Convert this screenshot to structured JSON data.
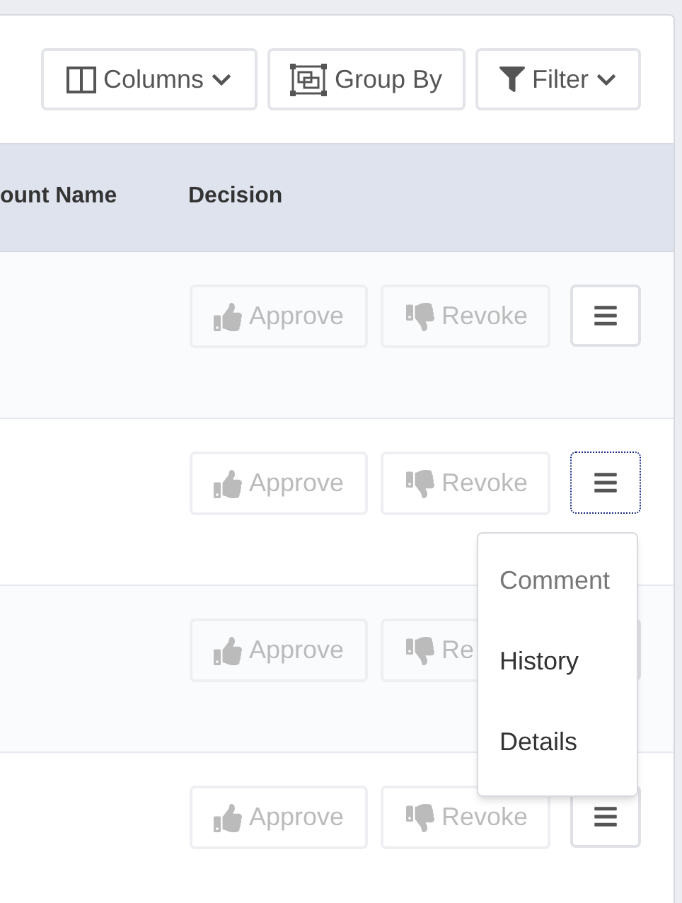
{
  "toolbar": {
    "buttons": [
      {
        "kind": "columns",
        "label": "Columns",
        "caret": true
      },
      {
        "kind": "group",
        "label": "Group By",
        "caret": false
      },
      {
        "kind": "filter",
        "label": "Filter",
        "caret": true
      }
    ]
  },
  "table": {
    "columns": [
      "ount Name",
      "Decision"
    ],
    "rows": [
      {
        "approve": "Approve",
        "revoke": "Revoke",
        "approve_disabled": true,
        "revoke_disabled": true,
        "focused": false
      },
      {
        "approve": "Approve",
        "revoke": "Revoke",
        "approve_disabled": true,
        "revoke_disabled": true,
        "focused": true
      },
      {
        "approve": "Approve",
        "revoke": "Re",
        "approve_disabled": true,
        "revoke_disabled": true,
        "focused": false,
        "menu_icon": false
      },
      {
        "approve": "Approve",
        "revoke": "Revoke",
        "approve_disabled": true,
        "revoke_disabled": true,
        "focused": false
      }
    ]
  },
  "menu": {
    "items": [
      {
        "label": "Comment",
        "disabled": true
      },
      {
        "label": "History",
        "disabled": false
      },
      {
        "label": "Details",
        "disabled": false
      }
    ]
  }
}
